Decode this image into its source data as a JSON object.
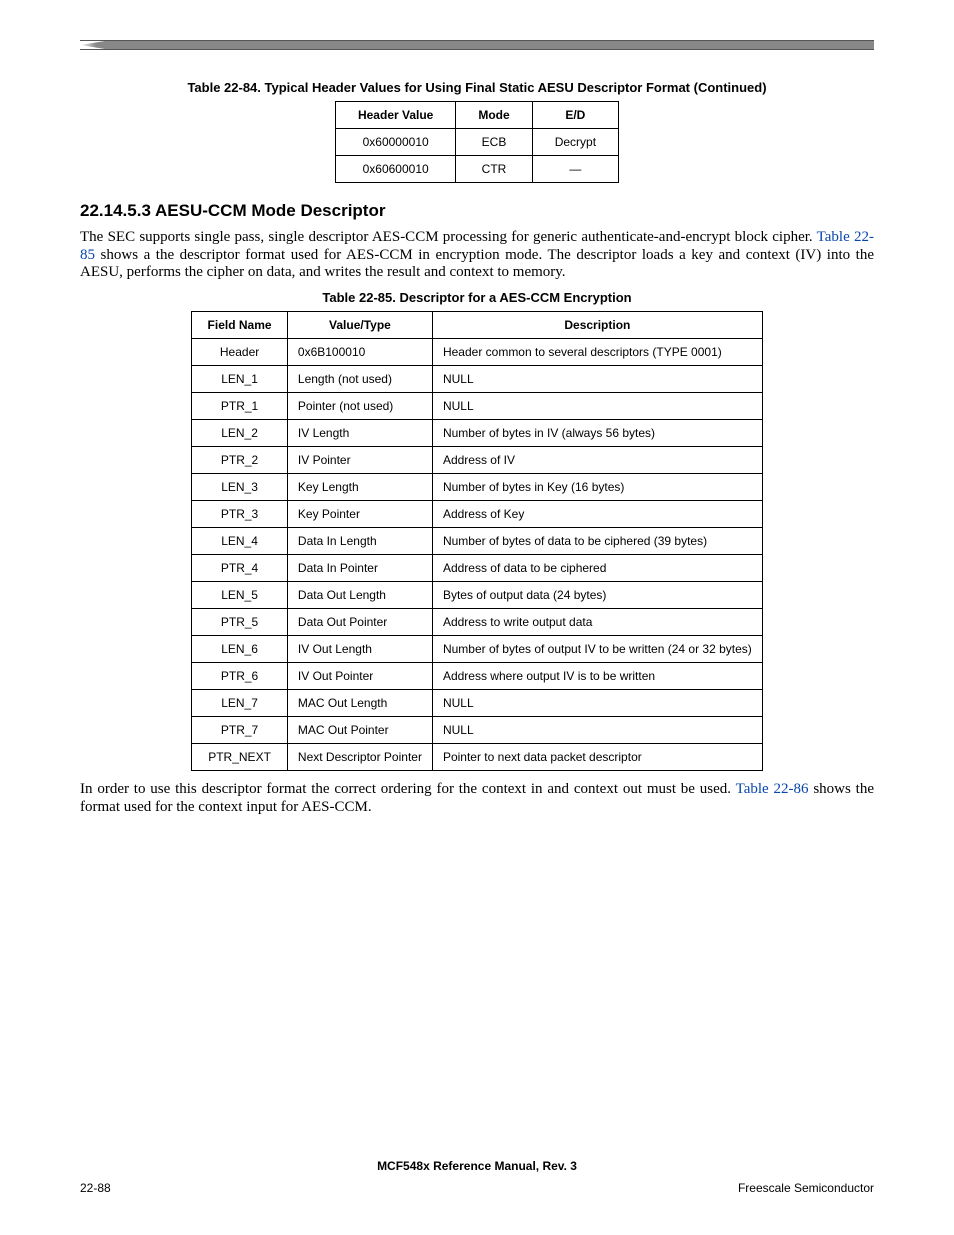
{
  "table84": {
    "caption": "Table 22-84. Typical Header Values for Using Final Static AESU Descriptor Format (Continued)",
    "headers": [
      "Header Value",
      "Mode",
      "E/D"
    ],
    "rows": [
      {
        "c0": "0x60000010",
        "c1": "ECB",
        "c2": "Decrypt"
      },
      {
        "c0": "0x60600010",
        "c1": "CTR",
        "c2": "—"
      }
    ]
  },
  "section": {
    "number": "22.14.5.3",
    "title": "AESU-CCM Mode Descriptor"
  },
  "para1": {
    "t0": "The SEC supports single pass, single descriptor AES-CCM processing for generic authenticate-and-encrypt block cipher. ",
    "link": "Table 22-85",
    "t1": " shows a the descriptor format used for AES-CCM in encryption mode. The descriptor loads a key and context (IV) into the AESU, performs the cipher on data, and writes the result and context to memory."
  },
  "table85": {
    "caption": "Table 22-85. Descriptor for a AES-CCM Encryption",
    "headers": [
      "Field Name",
      "Value/Type",
      "Description"
    ],
    "rows": [
      {
        "c0": "Header",
        "c1": "0x6B100010",
        "c2": "Header common to several descriptors (TYPE 0001)"
      },
      {
        "c0": "LEN_1",
        "c1": "Length (not used)",
        "c2": "NULL"
      },
      {
        "c0": "PTR_1",
        "c1": "Pointer (not used)",
        "c2": "NULL"
      },
      {
        "c0": "LEN_2",
        "c1": "IV Length",
        "c2": "Number of bytes in IV (always 56 bytes)"
      },
      {
        "c0": "PTR_2",
        "c1": "IV Pointer",
        "c2": "Address of IV"
      },
      {
        "c0": "LEN_3",
        "c1": "Key Length",
        "c2": "Number of bytes in Key (16 bytes)"
      },
      {
        "c0": "PTR_3",
        "c1": "Key Pointer",
        "c2": "Address of Key"
      },
      {
        "c0": "LEN_4",
        "c1": "Data In Length",
        "c2": "Number of bytes of data to be ciphered (39 bytes)"
      },
      {
        "c0": "PTR_4",
        "c1": "Data In Pointer",
        "c2": "Address of data to be ciphered"
      },
      {
        "c0": "LEN_5",
        "c1": "Data Out Length",
        "c2": "Bytes of output data (24 bytes)"
      },
      {
        "c0": "PTR_5",
        "c1": "Data Out Pointer",
        "c2": "Address to write output data"
      },
      {
        "c0": "LEN_6",
        "c1": "IV Out Length",
        "c2": "Number of bytes of output IV to be written (24 or 32 bytes)"
      },
      {
        "c0": "PTR_6",
        "c1": "IV Out Pointer",
        "c2": "Address where output IV is to be written"
      },
      {
        "c0": "LEN_7",
        "c1": "MAC Out Length",
        "c2": "NULL"
      },
      {
        "c0": "PTR_7",
        "c1": "MAC Out Pointer",
        "c2": "NULL"
      },
      {
        "c0": "PTR_NEXT",
        "c1": "Next Descriptor Pointer",
        "c2": "Pointer to next data packet descriptor"
      }
    ]
  },
  "para2": {
    "t0": "In order to use this descriptor format the correct ordering for the context in and context out must be used. ",
    "link": "Table 22-86",
    "t1": " shows the format used for the context input for AES-CCM."
  },
  "footer": {
    "title": "MCF548x Reference Manual, Rev. 3",
    "left": "22-88",
    "right": "Freescale Semiconductor"
  }
}
